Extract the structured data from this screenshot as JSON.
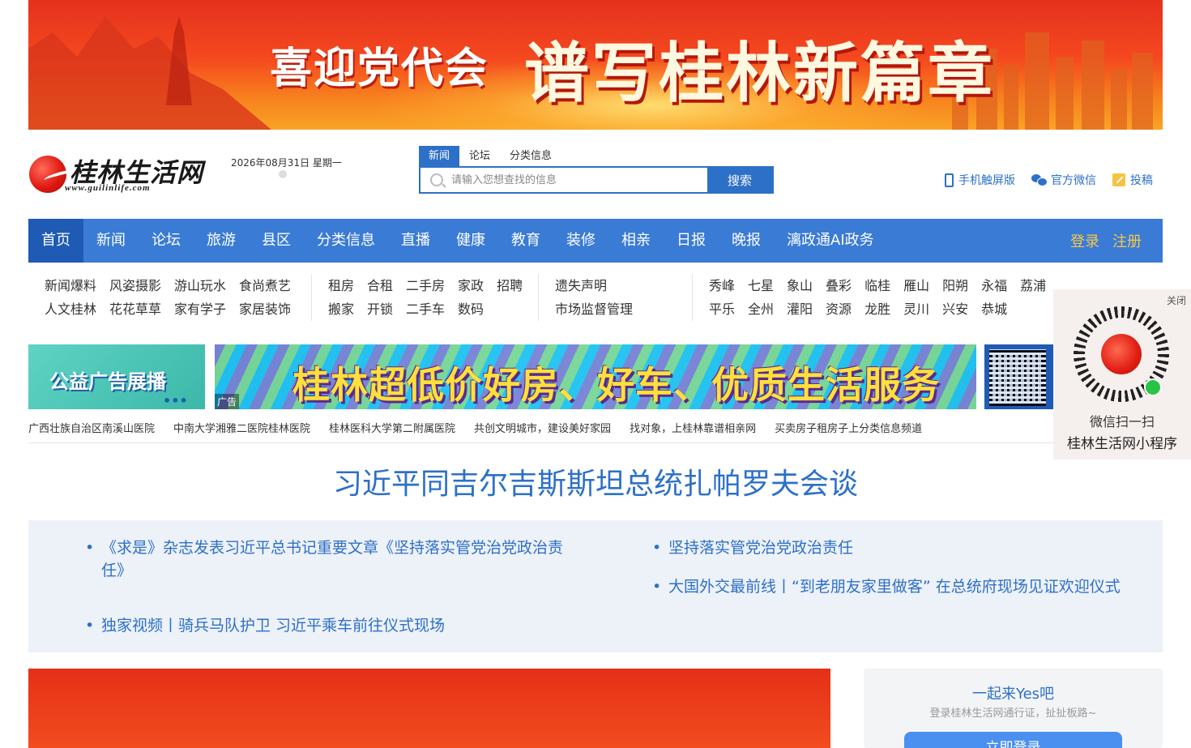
{
  "banner": {
    "small_text": "喜迎党代会",
    "big_text": "谱写桂林新篇章"
  },
  "logo": {
    "name": "桂林生活网",
    "url": "www.guilinlife.com"
  },
  "date_text": "2026年08月31日 星期一",
  "search": {
    "tabs": [
      "新闻",
      "论坛",
      "分类信息"
    ],
    "active_tab": "新闻",
    "placeholder": "请输入您想查找的信息",
    "value": "",
    "button_label": "搜索"
  },
  "top_links": {
    "mobile": "手机触屏版",
    "wechat": "官方微信",
    "submit": "投稿"
  },
  "nav": {
    "items": [
      "首页",
      "新闻",
      "论坛",
      "旅游",
      "县区",
      "分类信息",
      "直播",
      "健康",
      "教育",
      "装修",
      "相亲",
      "日报",
      "晚报",
      "漓政通AI政务"
    ],
    "active": "首页",
    "login": "登录",
    "register": "注册"
  },
  "sub_groups": {
    "news": [
      [
        "新闻爆料",
        "风姿摄影",
        "游山玩水",
        "食尚煮艺"
      ],
      [
        "人文桂林",
        "花花草草",
        "家有学子",
        "家居装饰"
      ]
    ],
    "classified": [
      [
        "租房",
        "合租",
        "二手房",
        "家政",
        "招聘"
      ],
      [
        "搬家",
        "开锁",
        "二手车",
        "数码"
      ]
    ],
    "notice": [
      [
        "遗失声明"
      ],
      [
        "市场监督管理"
      ]
    ],
    "county": [
      [
        "秀峰",
        "七星",
        "象山",
        "叠彩",
        "临桂",
        "雁山",
        "阳朔",
        "永福",
        "荔浦"
      ],
      [
        "平乐",
        "全州",
        "灌阳",
        "资源",
        "龙胜",
        "灵川",
        "兴安",
        "恭城"
      ]
    ]
  },
  "ads": {
    "left_text": "公益广告展播",
    "left_dots": "•••",
    "mid_text": "桂林超低价好房、好车、优质生活服务",
    "mid_tag": "广告"
  },
  "links_row": [
    "广西壮族自治区南溪山医院",
    "中南大学湘雅二医院桂林医院",
    "桂林医科大学第二附属医院",
    "共创文明城市，建设美好家园",
    "找对象，上桂林靠谱相亲网",
    "买卖房子租房子上分类信息频道"
  ],
  "headline": "习近平同吉尔吉斯斯坦总统扎帕罗夫会谈",
  "news": {
    "left": [
      "《求是》杂志发表习近平总书记重要文章《坚持落实管党治党政治责任》",
      "独家视频丨骑兵马队护卫 习近平乘车前往仪式现场"
    ],
    "right": [
      "坚持落实管党治党政治责任",
      "大国外交最前线丨“到老朋友家里做客” 在总统府现场见证欢迎仪式"
    ]
  },
  "login_card": {
    "title": "一起来Yes吧",
    "subtitle": "登录桂林生活网通行证，扯扯板路~",
    "button": "立即登录"
  },
  "float_panel": {
    "close": "关闭",
    "line1": "微信扫一扫",
    "line2": "桂林生活网小程序"
  }
}
